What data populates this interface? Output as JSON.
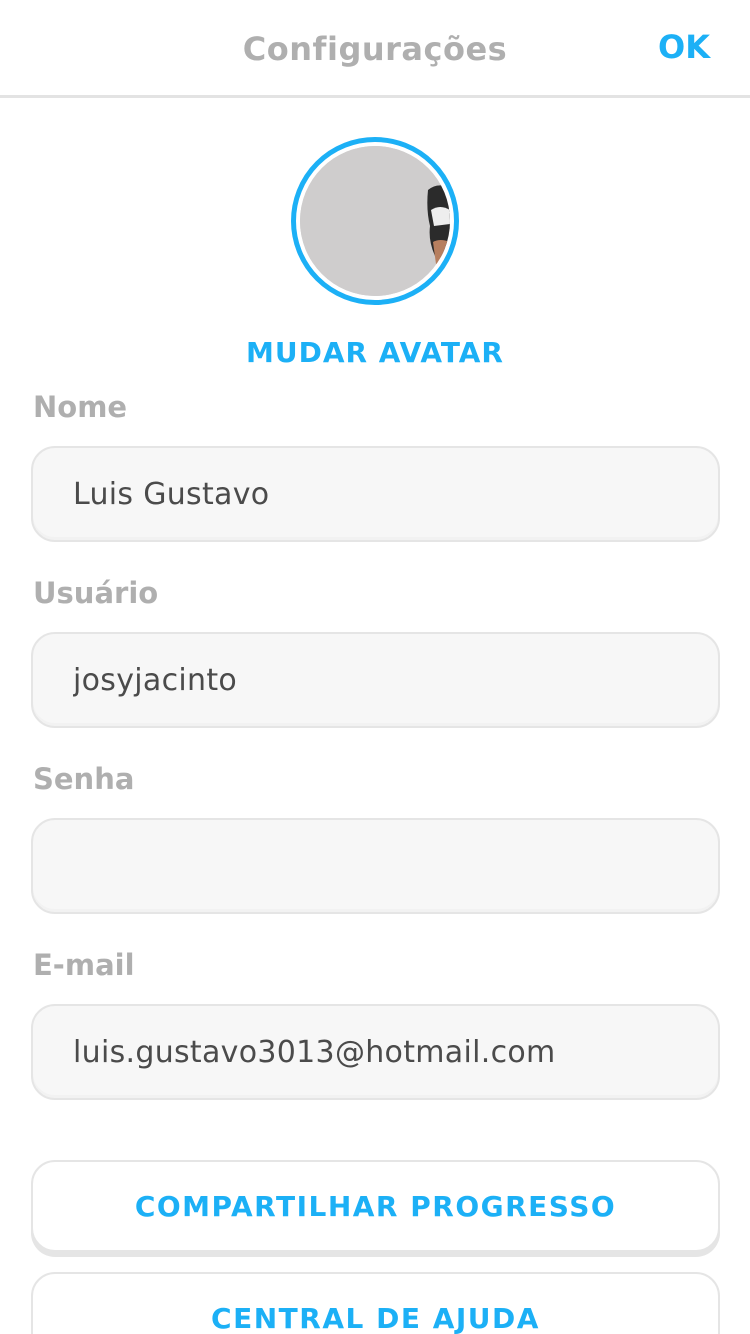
{
  "header": {
    "title": "Configurações",
    "ok_label": "OK"
  },
  "avatar": {
    "change_label": "MUDAR AVATAR"
  },
  "fields": {
    "name": {
      "label": "Nome",
      "value": "Luis Gustavo"
    },
    "username": {
      "label": "Usuário",
      "value": "josyjacinto"
    },
    "password": {
      "label": "Senha",
      "value": ""
    },
    "email": {
      "label": "E-mail",
      "value": "luis.gustavo3013@hotmail.com"
    }
  },
  "buttons": {
    "share_progress": "COMPARTILHAR PROGRESSO",
    "help_center": "CENTRAL DE AJUDA"
  },
  "colors": {
    "accent": "#1cb0f6",
    "label_gray": "#afafaf",
    "field_bg": "#f7f7f7",
    "border": "#e5e5e5"
  }
}
